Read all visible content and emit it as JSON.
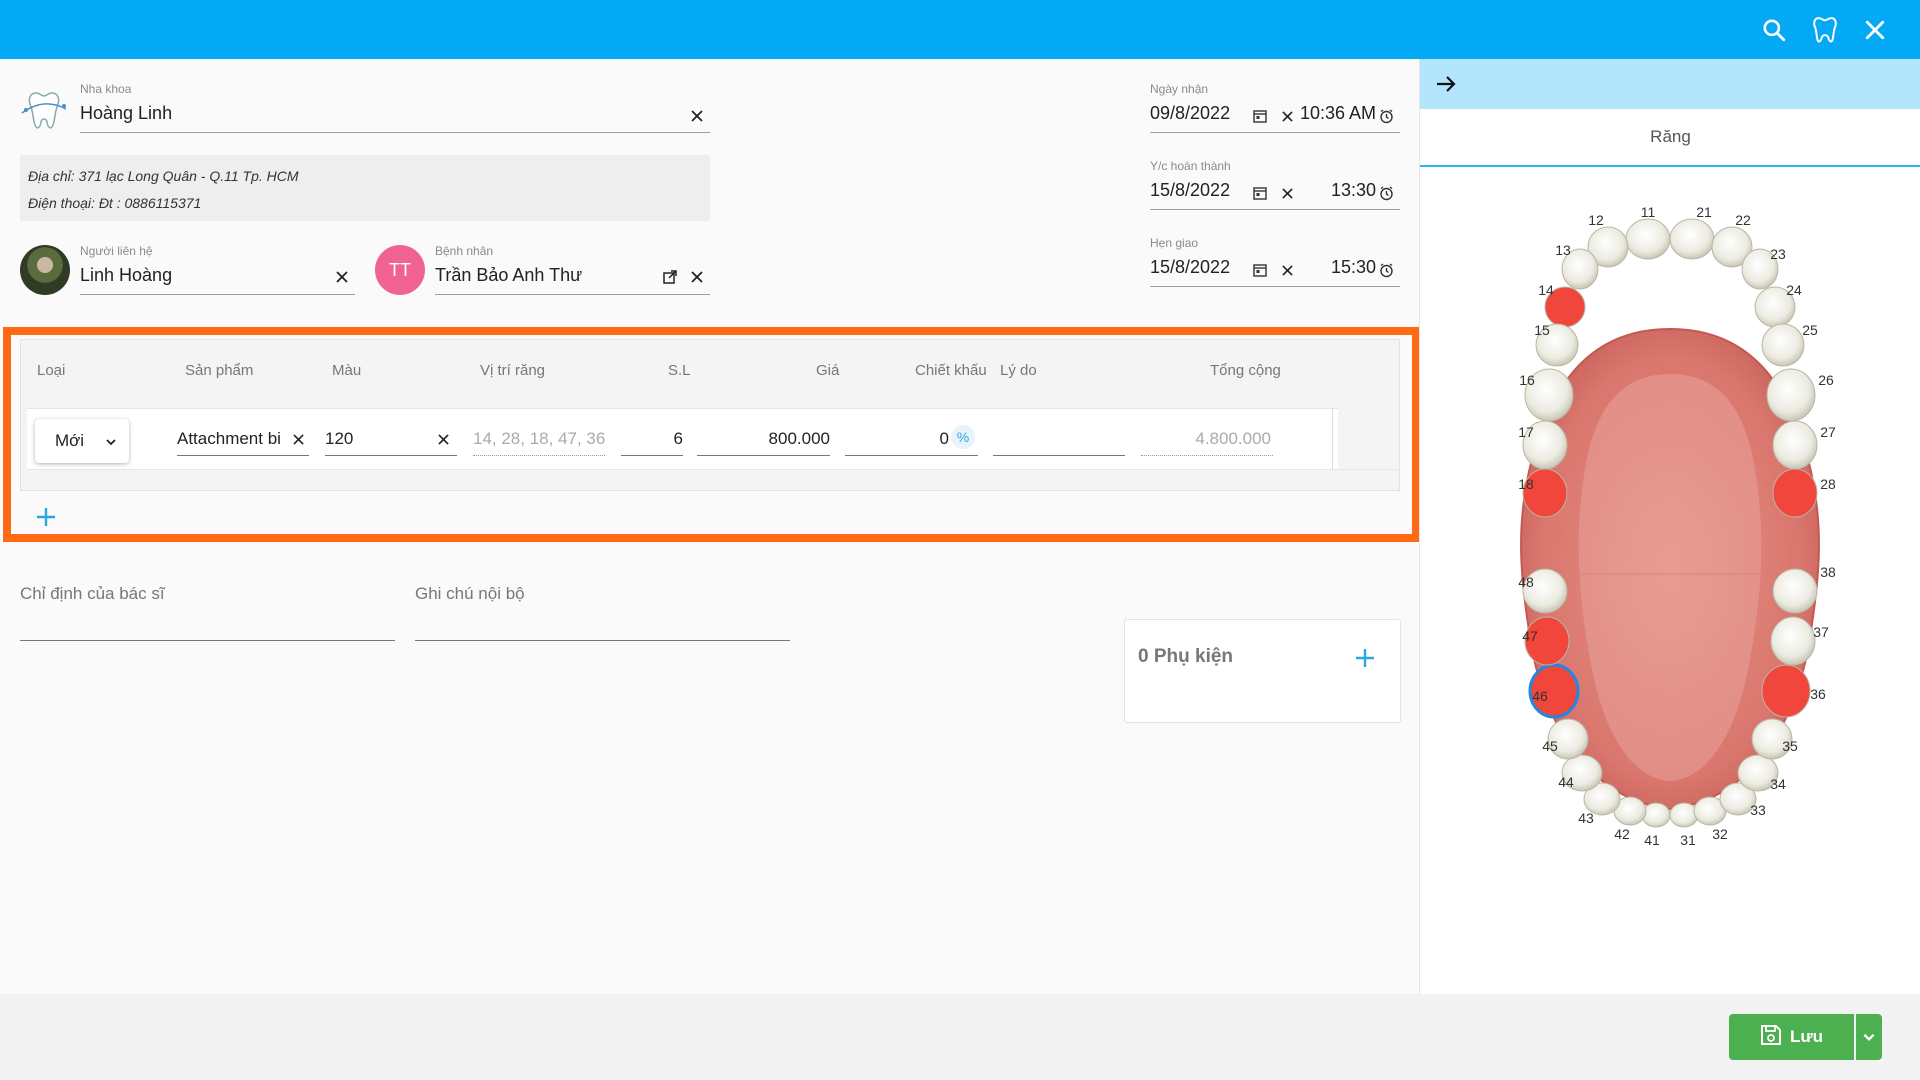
{
  "topbar": {
    "icons": [
      "search-icon",
      "tooth-icon",
      "close-icon"
    ],
    "color": "#03a9f4"
  },
  "clinic": {
    "label": "Nha khoa",
    "value": "Hoàng Linh",
    "address": "Địa chỉ: 371 lạc Long Quân - Q.11 Tp. HCM",
    "phone": "Điện thoại: Đt : 0886115371"
  },
  "contact": {
    "label": "Người liên hệ",
    "value": "Linh Hoàng"
  },
  "patient": {
    "label": "Bệnh nhân",
    "initials": "TT",
    "value": "Trần Bảo Anh Thư"
  },
  "dates": {
    "received": {
      "label": "Ngày nhận",
      "date": "09/8/2022",
      "time": "10:36 AM"
    },
    "complete": {
      "label": "Y/c hoàn thành",
      "date": "15/8/2022",
      "time": "13:30"
    },
    "delivery": {
      "label": "Hẹn giao",
      "date": "15/8/2022",
      "time": "15:30"
    }
  },
  "table": {
    "headers": {
      "type": "Loại",
      "product": "Sản phẩm",
      "color": "Màu",
      "position": "Vị trí răng",
      "qty": "S.L",
      "price": "Giá",
      "discount": "Chiết khấu",
      "reason": "Lý do",
      "total": "Tổng cộng"
    },
    "row": {
      "type": "Mới",
      "product": "Attachment bi",
      "color": "120",
      "position": "14, 28, 18, 47, 36,",
      "qty": "6",
      "price": "800.000",
      "discount": "0",
      "discount_unit": "%",
      "reason": "",
      "total": "4.800.000"
    }
  },
  "notes": {
    "doctor_label": "Chỉ định của bác sĩ",
    "internal_label": "Ghi chú nội bộ"
  },
  "accessories": {
    "label": "0 Phụ kiện"
  },
  "right_panel": {
    "tab": "Răng",
    "teeth_numbers": [
      "11",
      "12",
      "13",
      "14",
      "15",
      "16",
      "17",
      "18",
      "21",
      "22",
      "23",
      "24",
      "25",
      "26",
      "27",
      "28",
      "31",
      "32",
      "33",
      "34",
      "35",
      "36",
      "37",
      "38",
      "41",
      "42",
      "43",
      "44",
      "45",
      "46",
      "47",
      "48"
    ],
    "selected_teeth": [
      "14",
      "18",
      "28",
      "47",
      "46",
      "36"
    ],
    "focused_tooth": "46",
    "selected_color": "#f0463c"
  },
  "footer": {
    "save_label": "Lưu",
    "accent": "#4caf50"
  }
}
